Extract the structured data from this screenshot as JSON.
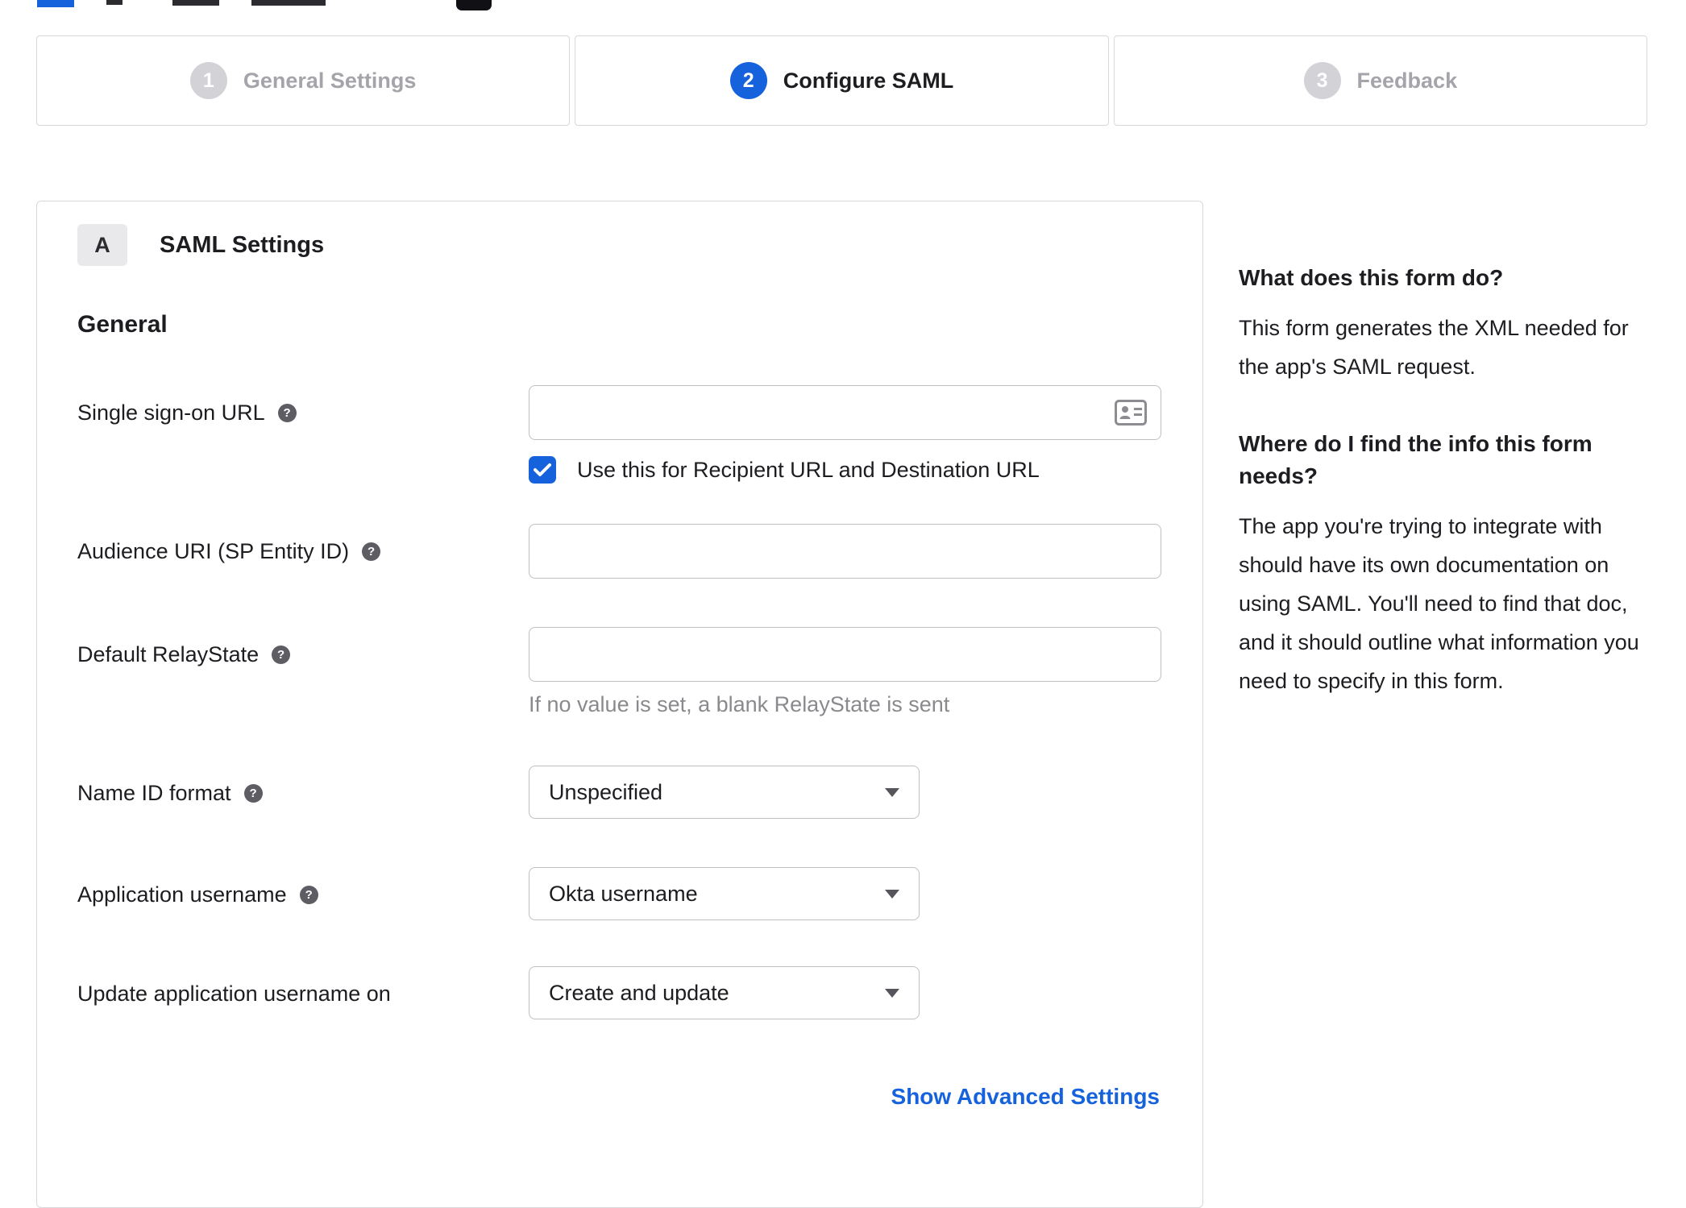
{
  "colors": {
    "accent": "#1662dd",
    "inactive_gray": "#a4a4aa",
    "border_gray": "#d8d8dc"
  },
  "icons": {
    "help": "?"
  },
  "stepper": {
    "steps": [
      {
        "number": "1",
        "label": "General Settings",
        "state": "inactive"
      },
      {
        "number": "2",
        "label": "Configure SAML",
        "state": "active"
      },
      {
        "number": "3",
        "label": "Feedback",
        "state": "inactive"
      }
    ]
  },
  "panel": {
    "badge": "A",
    "title": "SAML Settings",
    "section_heading": "General",
    "rows": {
      "sso": {
        "label": "Single sign-on URL",
        "value": "",
        "checkbox": {
          "label": "Use this for Recipient URL and Destination URL",
          "checked": true
        }
      },
      "audience": {
        "label": "Audience URI (SP Entity ID)",
        "value": ""
      },
      "relay": {
        "label": "Default RelayState",
        "value": "",
        "helper": "If no value is set, a blank RelayState is sent"
      },
      "name_id": {
        "label": "Name ID format",
        "value": "Unspecified"
      },
      "app_username": {
        "label": "Application username",
        "value": "Okta username"
      },
      "update_username": {
        "label": "Update application username on",
        "value": "Create and update"
      }
    },
    "advanced_link": "Show Advanced Settings"
  },
  "sidebar": {
    "q1": "What does this form do?",
    "a1": "This form generates the XML needed for the app's SAML request.",
    "q2": "Where do I find the info this form needs?",
    "a2": "The app you're trying to integrate with should have its own documentation on using SAML. You'll need to find that doc, and it should outline what information you need to specify in this form."
  }
}
